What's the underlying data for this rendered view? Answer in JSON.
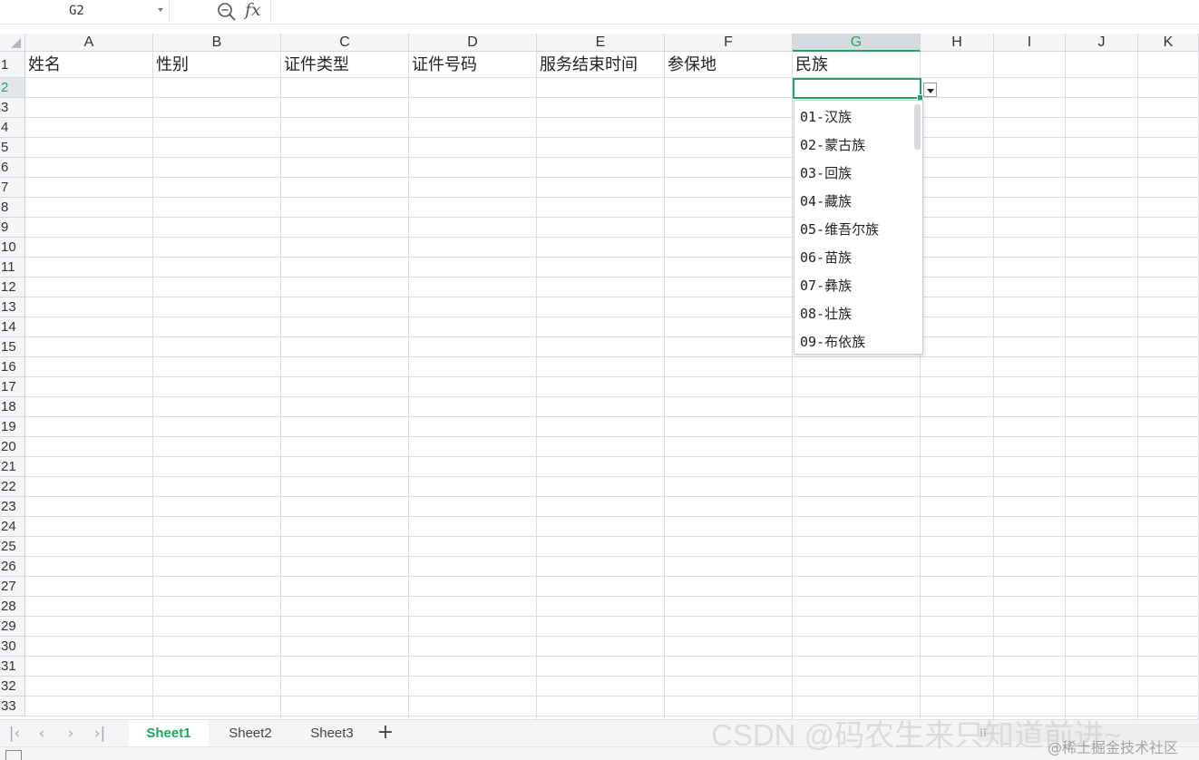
{
  "formula_bar": {
    "name_box": "G2",
    "fx": "fx",
    "formula": ""
  },
  "columns": [
    "A",
    "B",
    "C",
    "D",
    "E",
    "F",
    "G",
    "H",
    "I",
    "J",
    "K"
  ],
  "selected_column": "G",
  "rows": [
    "1",
    "2",
    "3",
    "4",
    "5",
    "6",
    "7",
    "8",
    "9",
    "10",
    "11",
    "12",
    "13",
    "14",
    "15",
    "16",
    "17",
    "18",
    "19",
    "20",
    "21",
    "22",
    "23",
    "24",
    "25",
    "26",
    "27",
    "28",
    "29",
    "30",
    "31",
    "32",
    "33"
  ],
  "selected_row": "2",
  "headers": [
    "姓名",
    "性别",
    "证件类型",
    "证件号码",
    "服务结束时间",
    "参保地",
    "民族"
  ],
  "active_cell": {
    "ref": "G2",
    "value": ""
  },
  "dropdown_options": [
    "01-汉族",
    "02-蒙古族",
    "03-回族",
    "04-藏族",
    "05-维吾尔族",
    "06-苗族",
    "07-彝族",
    "08-壮族",
    "09-布依族"
  ],
  "sheets": [
    {
      "name": "Sheet1",
      "active": true
    },
    {
      "name": "Sheet2",
      "active": false
    },
    {
      "name": "Sheet3",
      "active": false
    }
  ],
  "add_sheet_label": "+",
  "watermark": "CSDN @码农生来只知道前进~",
  "watermark_small": "@稀土掘金技术社区",
  "accent_color": "#21a366"
}
